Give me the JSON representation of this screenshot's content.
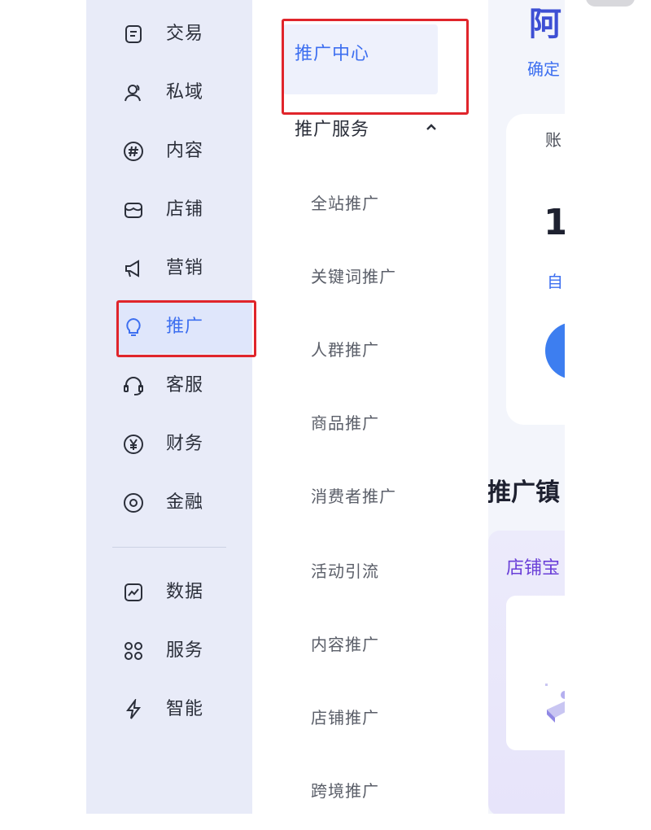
{
  "sidebar": {
    "items": [
      {
        "label": "交易",
        "icon": "document-icon"
      },
      {
        "label": "私域",
        "icon": "users-icon"
      },
      {
        "label": "内容",
        "icon": "hashtag-icon"
      },
      {
        "label": "店铺",
        "icon": "shop-icon"
      },
      {
        "label": "营销",
        "icon": "megaphone-icon"
      },
      {
        "label": "推广",
        "icon": "lightbulb-icon",
        "active": true
      },
      {
        "label": "客服",
        "icon": "headset-icon"
      },
      {
        "label": "财务",
        "icon": "yuan-icon"
      },
      {
        "label": "金融",
        "icon": "target-icon"
      },
      {
        "label": "数据",
        "icon": "chart-icon"
      },
      {
        "label": "服务",
        "icon": "grid-icon"
      },
      {
        "label": "智能",
        "icon": "lightning-icon"
      }
    ]
  },
  "submenu": {
    "center_label": "推广中心",
    "group_label": "推广服务",
    "items": [
      "全站推广",
      "关键词推广",
      "人群推广",
      "商品推广",
      "消费者推广",
      "活动引流",
      "内容推广",
      "店铺推广",
      "跨境推广"
    ]
  },
  "content": {
    "title": "阿",
    "subtitle": "确定",
    "card_label": "账",
    "card_value": "1",
    "card_link": "自",
    "section_title": "推广镇",
    "promo_label": "店铺宝"
  },
  "colors": {
    "accent": "#3d6ff0",
    "highlight_border": "#e0252b",
    "sidebar_bg": "#e8ebf8"
  }
}
